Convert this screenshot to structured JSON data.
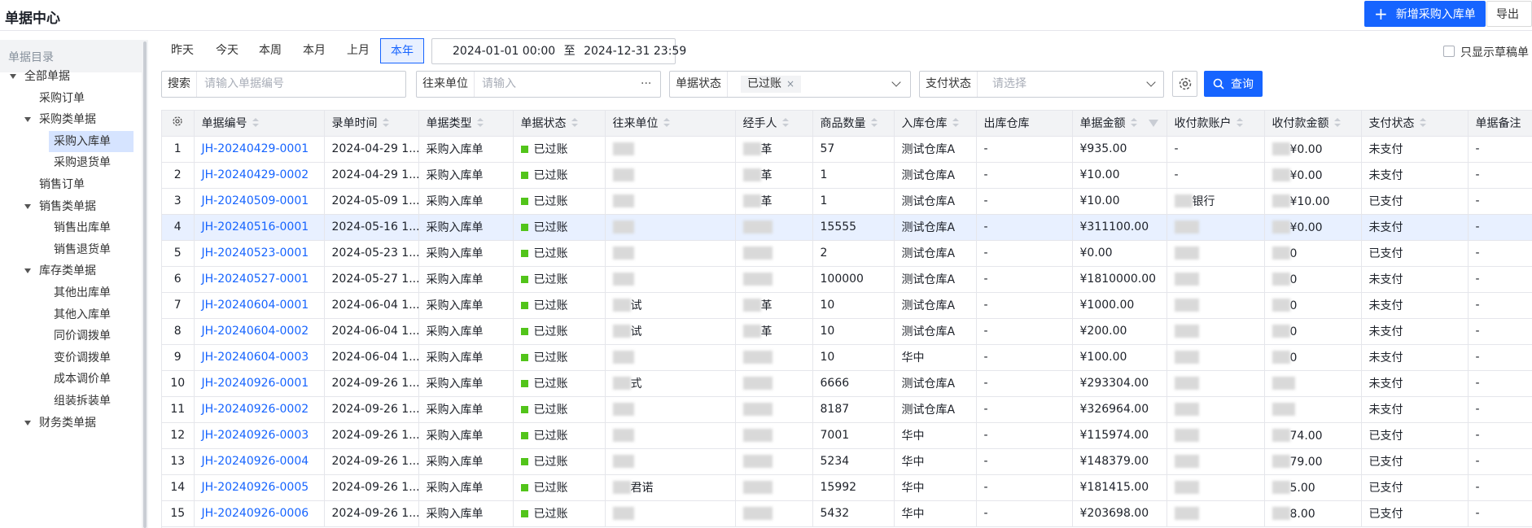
{
  "header": {
    "title": "单据中心",
    "new_button": "新增采购入库单",
    "export_button": "导出"
  },
  "sidebar": {
    "title": "单据目录",
    "items": [
      {
        "label": "全部单据",
        "level": 0,
        "expanded": true
      },
      {
        "label": "采购订单",
        "level": 1
      },
      {
        "label": "采购类单据",
        "level": 1,
        "expanded": true
      },
      {
        "label": "采购入库单",
        "level": 2,
        "selected": true
      },
      {
        "label": "采购退货单",
        "level": 2
      },
      {
        "label": "销售订单",
        "level": 1
      },
      {
        "label": "销售类单据",
        "level": 1,
        "expanded": true
      },
      {
        "label": "销售出库单",
        "level": 2
      },
      {
        "label": "销售退货单",
        "level": 2
      },
      {
        "label": "库存类单据",
        "level": 1,
        "expanded": true
      },
      {
        "label": "其他出库单",
        "level": 2
      },
      {
        "label": "其他入库单",
        "level": 2
      },
      {
        "label": "同价调拨单",
        "level": 2
      },
      {
        "label": "变价调拨单",
        "level": 2
      },
      {
        "label": "成本调价单",
        "level": 2
      },
      {
        "label": "组装拆装单",
        "level": 2
      },
      {
        "label": "财务类单据",
        "level": 1,
        "expanded": true
      }
    ]
  },
  "toolbar": {
    "ranges": [
      "昨天",
      "今天",
      "本周",
      "本月",
      "上月",
      "本年"
    ],
    "active_range": "本年",
    "date_start": "2024-01-01 00:00",
    "date_sep": "至",
    "date_end": "2024-12-31 23:59",
    "draft_only": "只显示草稿单"
  },
  "filters": {
    "search_label": "搜索",
    "search_placeholder": "请输入单据编号",
    "partner_label": "往来单位",
    "partner_placeholder": "请输入",
    "partner_more": "···",
    "status_label": "单据状态",
    "status_tag": "已过账",
    "status_tag_close": "×",
    "pay_label": "支付状态",
    "pay_placeholder": "请选择",
    "query_button": "查询"
  },
  "table": {
    "columns": [
      "单据编号",
      "录单时间",
      "单据类型",
      "单据状态",
      "往来单位",
      "经手人",
      "商品数量",
      "入库仓库",
      "出库仓库",
      "单据金额",
      "收付款账户",
      "收付款金额",
      "支付状态",
      "单据备注"
    ],
    "rows": [
      {
        "idx": "1",
        "no": "JH-20240429-0001",
        "time": "2024-04-29 1...",
        "type": "采购入库单",
        "status": "已过账",
        "partner": "",
        "handler": "革",
        "qty": "57",
        "in_wh": "测试仓库A",
        "out_wh": "-",
        "amount": "¥935.00",
        "account": "-",
        "pay_amount": "¥0.00",
        "pay_status": "未支付",
        "note": "-"
      },
      {
        "idx": "2",
        "no": "JH-20240429-0002",
        "time": "2024-04-29 1...",
        "type": "采购入库单",
        "status": "已过账",
        "partner": "",
        "handler": "革",
        "qty": "1",
        "in_wh": "测试仓库A",
        "out_wh": "-",
        "amount": "¥10.00",
        "account": "-",
        "pay_amount": "¥0.00",
        "pay_status": "未支付",
        "note": "-"
      },
      {
        "idx": "3",
        "no": "JH-20240509-0001",
        "time": "2024-05-09 1...",
        "type": "采购入库单",
        "status": "已过账",
        "partner": "",
        "handler": "革",
        "qty": "1",
        "in_wh": "测试仓库A",
        "out_wh": "-",
        "amount": "¥10.00",
        "account": "银行",
        "pay_amount": "¥10.00",
        "pay_status": "已支付",
        "note": "-"
      },
      {
        "idx": "4",
        "no": "JH-20240516-0001",
        "time": "2024-05-16 1...",
        "type": "采购入库单",
        "status": "已过账",
        "partner": "",
        "handler": "",
        "qty": "15555",
        "in_wh": "测试仓库A",
        "out_wh": "-",
        "amount": "¥311100.00",
        "account": "",
        "pay_amount": "¥0.00",
        "pay_status": "未支付",
        "note": "-"
      },
      {
        "idx": "5",
        "no": "JH-20240523-0001",
        "time": "2024-05-23 1...",
        "type": "采购入库单",
        "status": "已过账",
        "partner": "",
        "handler": "",
        "qty": "2",
        "in_wh": "测试仓库A",
        "out_wh": "-",
        "amount": "¥0.00",
        "account": "",
        "pay_amount": "0",
        "pay_status": "已支付",
        "note": "-"
      },
      {
        "idx": "6",
        "no": "JH-20240527-0001",
        "time": "2024-05-27 1...",
        "type": "采购入库单",
        "status": "已过账",
        "partner": "",
        "handler": "",
        "qty": "100000",
        "in_wh": "测试仓库A",
        "out_wh": "-",
        "amount": "¥1810000.00",
        "account": "",
        "pay_amount": "0",
        "pay_status": "未支付",
        "note": "-"
      },
      {
        "idx": "7",
        "no": "JH-20240604-0001",
        "time": "2024-06-04 1...",
        "type": "采购入库单",
        "status": "已过账",
        "partner": "试",
        "handler": "革",
        "qty": "10",
        "in_wh": "测试仓库A",
        "out_wh": "-",
        "amount": "¥1000.00",
        "account": "",
        "pay_amount": "0",
        "pay_status": "未支付",
        "note": "-"
      },
      {
        "idx": "8",
        "no": "JH-20240604-0002",
        "time": "2024-06-04 1...",
        "type": "采购入库单",
        "status": "已过账",
        "partner": "试",
        "handler": "革",
        "qty": "10",
        "in_wh": "测试仓库A",
        "out_wh": "-",
        "amount": "¥200.00",
        "account": "",
        "pay_amount": "0",
        "pay_status": "未支付",
        "note": "-"
      },
      {
        "idx": "9",
        "no": "JH-20240604-0003",
        "time": "2024-06-04 1...",
        "type": "采购入库单",
        "status": "已过账",
        "partner": "",
        "handler": "",
        "qty": "10",
        "in_wh": "华中",
        "out_wh": "-",
        "amount": "¥100.00",
        "account": "",
        "pay_amount": "0",
        "pay_status": "未支付",
        "note": "-"
      },
      {
        "idx": "10",
        "no": "JH-20240926-0001",
        "time": "2024-09-26 1...",
        "type": "采购入库单",
        "status": "已过账",
        "partner": "式",
        "handler": "",
        "qty": "6666",
        "in_wh": "测试仓库A",
        "out_wh": "-",
        "amount": "¥293304.00",
        "account": "",
        "pay_amount": "",
        "pay_status": "未支付",
        "note": "-"
      },
      {
        "idx": "11",
        "no": "JH-20240926-0002",
        "time": "2024-09-26 1...",
        "type": "采购入库单",
        "status": "已过账",
        "partner": "",
        "handler": "",
        "qty": "8187",
        "in_wh": "测试仓库A",
        "out_wh": "-",
        "amount": "¥326964.00",
        "account": "",
        "pay_amount": "",
        "pay_status": "未支付",
        "note": "-"
      },
      {
        "idx": "12",
        "no": "JH-20240926-0003",
        "time": "2024-09-26 1...",
        "type": "采购入库单",
        "status": "已过账",
        "partner": "",
        "handler": "",
        "qty": "7001",
        "in_wh": "华中",
        "out_wh": "-",
        "amount": "¥115974.00",
        "account": "",
        "pay_amount": "74.00",
        "pay_status": "已支付",
        "note": "-"
      },
      {
        "idx": "13",
        "no": "JH-20240926-0004",
        "time": "2024-09-26 1...",
        "type": "采购入库单",
        "status": "已过账",
        "partner": "",
        "handler": "",
        "qty": "5234",
        "in_wh": "华中",
        "out_wh": "-",
        "amount": "¥148379.00",
        "account": "",
        "pay_amount": "79.00",
        "pay_status": "已支付",
        "note": "-"
      },
      {
        "idx": "14",
        "no": "JH-20240926-0005",
        "time": "2024-09-26 1...",
        "type": "采购入库单",
        "status": "已过账",
        "partner": "君诺",
        "handler": "",
        "qty": "15992",
        "in_wh": "华中",
        "out_wh": "-",
        "amount": "¥181415.00",
        "account": "",
        "pay_amount": "5.00",
        "pay_status": "已支付",
        "note": "-"
      },
      {
        "idx": "15",
        "no": "JH-20240926-0006",
        "time": "2024-09-26 1...",
        "type": "采购入库单",
        "status": "已过账",
        "partner": "",
        "handler": "",
        "qty": "5432",
        "in_wh": "华中",
        "out_wh": "-",
        "amount": "¥203698.00",
        "account": "",
        "pay_amount": "8.00",
        "pay_status": "已支付",
        "note": "-"
      }
    ]
  },
  "colors": {
    "primary": "#1664ff",
    "selected_bg": "#d6e4ff",
    "posted_dot": "#52c41a",
    "header_bg": "#f2f3f5"
  }
}
